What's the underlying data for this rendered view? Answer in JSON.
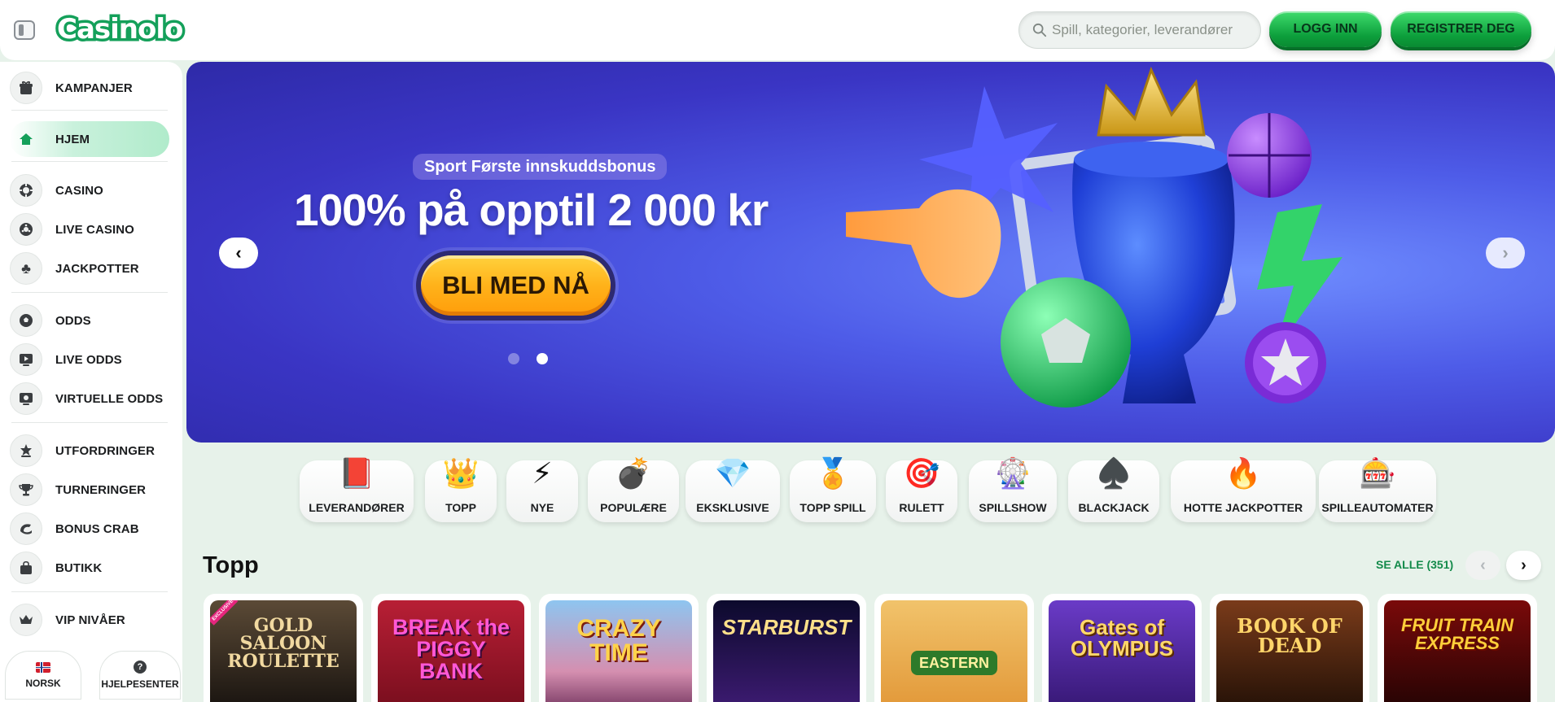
{
  "header": {
    "logo_text": "Casinolo",
    "search_placeholder": "Spill, kategorier, leverandører",
    "login_label": "LOGG INN",
    "register_label": "REGISTRER DEG"
  },
  "sidebar": {
    "items": [
      {
        "label": "KAMPANJER",
        "icon": "gift-icon"
      },
      {
        "label": "HJEM",
        "icon": "home-icon"
      },
      {
        "label": "CASINO",
        "icon": "casino-chip-icon"
      },
      {
        "label": "LIVE CASINO",
        "icon": "roulette-icon"
      },
      {
        "label": "JACKPOTTER",
        "icon": "clubs-icon"
      },
      {
        "label": "ODDS",
        "icon": "soccer-ball-icon"
      },
      {
        "label": "LIVE ODDS",
        "icon": "play-screen-icon"
      },
      {
        "label": "VIRTUELLE ODDS",
        "icon": "virtual-screen-icon"
      },
      {
        "label": "UTFORDRINGER",
        "icon": "star-badge-icon"
      },
      {
        "label": "TURNERINGER",
        "icon": "trophy-icon"
      },
      {
        "label": "BONUS CRAB",
        "icon": "claw-icon"
      },
      {
        "label": "BUTIKK",
        "icon": "shopping-bag-icon"
      },
      {
        "label": "VIP NIVÅER",
        "icon": "crown-icon"
      }
    ],
    "language_label": "NORSK",
    "help_label": "HJELPESENTER"
  },
  "hero": {
    "badge": "Sport Første innskuddsbonus",
    "title": "100% på opptil 2 000 kr",
    "cta": "BLI MED NÅ",
    "active_slide": 2,
    "slide_count": 2
  },
  "categories": [
    {
      "label": "LEVERANDØRER",
      "icon": "book-icon"
    },
    {
      "label": "TOPP",
      "icon": "crown-icon"
    },
    {
      "label": "NYE",
      "icon": "lightning-icon"
    },
    {
      "label": "POPULÆRE",
      "icon": "bomb-icon"
    },
    {
      "label": "EKSKLUSIVE",
      "icon": "diamond-icon"
    },
    {
      "label": "TOPP SPILL",
      "icon": "medal-icon"
    },
    {
      "label": "RULETT",
      "icon": "roulette-wheel-icon"
    },
    {
      "label": "SPILLSHOW",
      "icon": "wheel-icon"
    },
    {
      "label": "BLACKJACK",
      "icon": "spade-icon"
    },
    {
      "label": "HOTTE JACKPOTTER",
      "icon": "fire-icon"
    },
    {
      "label": "SPILLEAUTOMATER",
      "icon": "slot-machine-icon"
    }
  ],
  "games_section": {
    "title": "Topp",
    "see_all": "SE ALLE (351)",
    "games": [
      {
        "title": "GOLD SALOON ROULETTE",
        "badge": "EXCLUSIVE"
      },
      {
        "title": "BREAK the PIGGY BANK",
        "badge": ""
      },
      {
        "title": "CRAZY TIME",
        "badge": ""
      },
      {
        "title": "STARBURST",
        "badge": ""
      },
      {
        "title": "EASTERN",
        "badge": ""
      },
      {
        "title": "Gates of OLYMPUS",
        "badge": ""
      },
      {
        "title": "BOOK OF DEAD",
        "badge": ""
      },
      {
        "title": "FRUIT TRAIN EXPRESS",
        "badge": ""
      }
    ]
  },
  "colors": {
    "brand_green": "#14a05a",
    "hero_bg": "#3a35c4",
    "cta_orange": "#ffb21a",
    "page_bg": "#e7f2ea"
  }
}
